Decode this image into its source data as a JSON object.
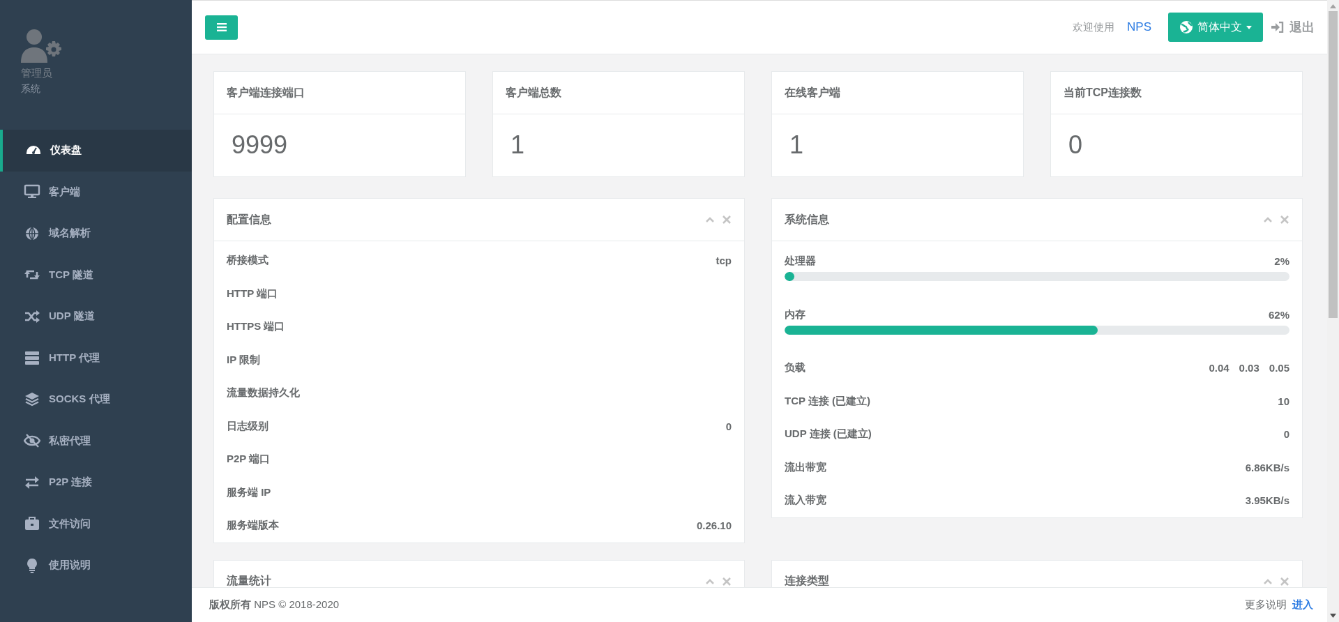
{
  "sidebar": {
    "user": {
      "name": "管理员",
      "role": "系统"
    },
    "items": [
      {
        "label": "仪表盘",
        "selected": true
      },
      {
        "label": "客户端",
        "selected": false
      },
      {
        "label": "域名解析",
        "selected": false
      },
      {
        "label": "TCP 隧道",
        "selected": false
      },
      {
        "label": "UDP 隧道",
        "selected": false
      },
      {
        "label": "HTTP 代理",
        "selected": false
      },
      {
        "label": "SOCKS 代理",
        "selected": false
      },
      {
        "label": "私密代理",
        "selected": false
      },
      {
        "label": "P2P 连接",
        "selected": false
      },
      {
        "label": "文件访问",
        "selected": false
      },
      {
        "label": "使用说明",
        "selected": false
      }
    ]
  },
  "header": {
    "welcome": "欢迎使用",
    "brand": "NPS",
    "language": "简体中文",
    "logout": "退出"
  },
  "stats": [
    {
      "title": "客户端连接端口",
      "value": "9999"
    },
    {
      "title": "客户端总数",
      "value": "1"
    },
    {
      "title": "在线客户端",
      "value": "1"
    },
    {
      "title": "当前TCP连接数",
      "value": "0"
    }
  ],
  "config_panel": {
    "title": "配置信息",
    "rows": [
      {
        "label": "桥接模式",
        "value": "tcp"
      },
      {
        "label": "HTTP 端口"
      },
      {
        "label": "HTTPS 端口"
      },
      {
        "label": "IP 限制"
      },
      {
        "label": "流量数据持久化"
      },
      {
        "label": "日志级别",
        "value": "0"
      },
      {
        "label": "P2P 端口"
      },
      {
        "label": "服务端 IP"
      },
      {
        "label": "服务端版本",
        "value": "0.26.10"
      }
    ]
  },
  "system_panel": {
    "title": "系统信息",
    "rows": [
      {
        "kind": "bar",
        "label": "处理器",
        "value": "2%",
        "level": 0.02
      },
      {
        "kind": "bar",
        "label": "内存",
        "value": "62%",
        "level": 0.62
      },
      {
        "kind": "multi",
        "label": "负载",
        "values": [
          "0.04",
          "0.03",
          "0.05"
        ]
      },
      {
        "kind": "text",
        "label": "TCP 连接 (已建立)",
        "value": "10"
      },
      {
        "kind": "text",
        "label": "UDP 连接 (已建立)",
        "value": "0"
      },
      {
        "kind": "text",
        "label": "流出带宽",
        "value": "6.86KB/s"
      },
      {
        "kind": "text",
        "label": "流入带宽",
        "value": "3.95KB/s"
      }
    ]
  },
  "lower_panels": [
    {
      "title": "流量统计"
    },
    {
      "title": "连接类型"
    }
  ],
  "footer": {
    "copyright_label": "版权所有",
    "copyright": "NPS © 2018-2020",
    "more": "更多说明",
    "link": "进入"
  }
}
